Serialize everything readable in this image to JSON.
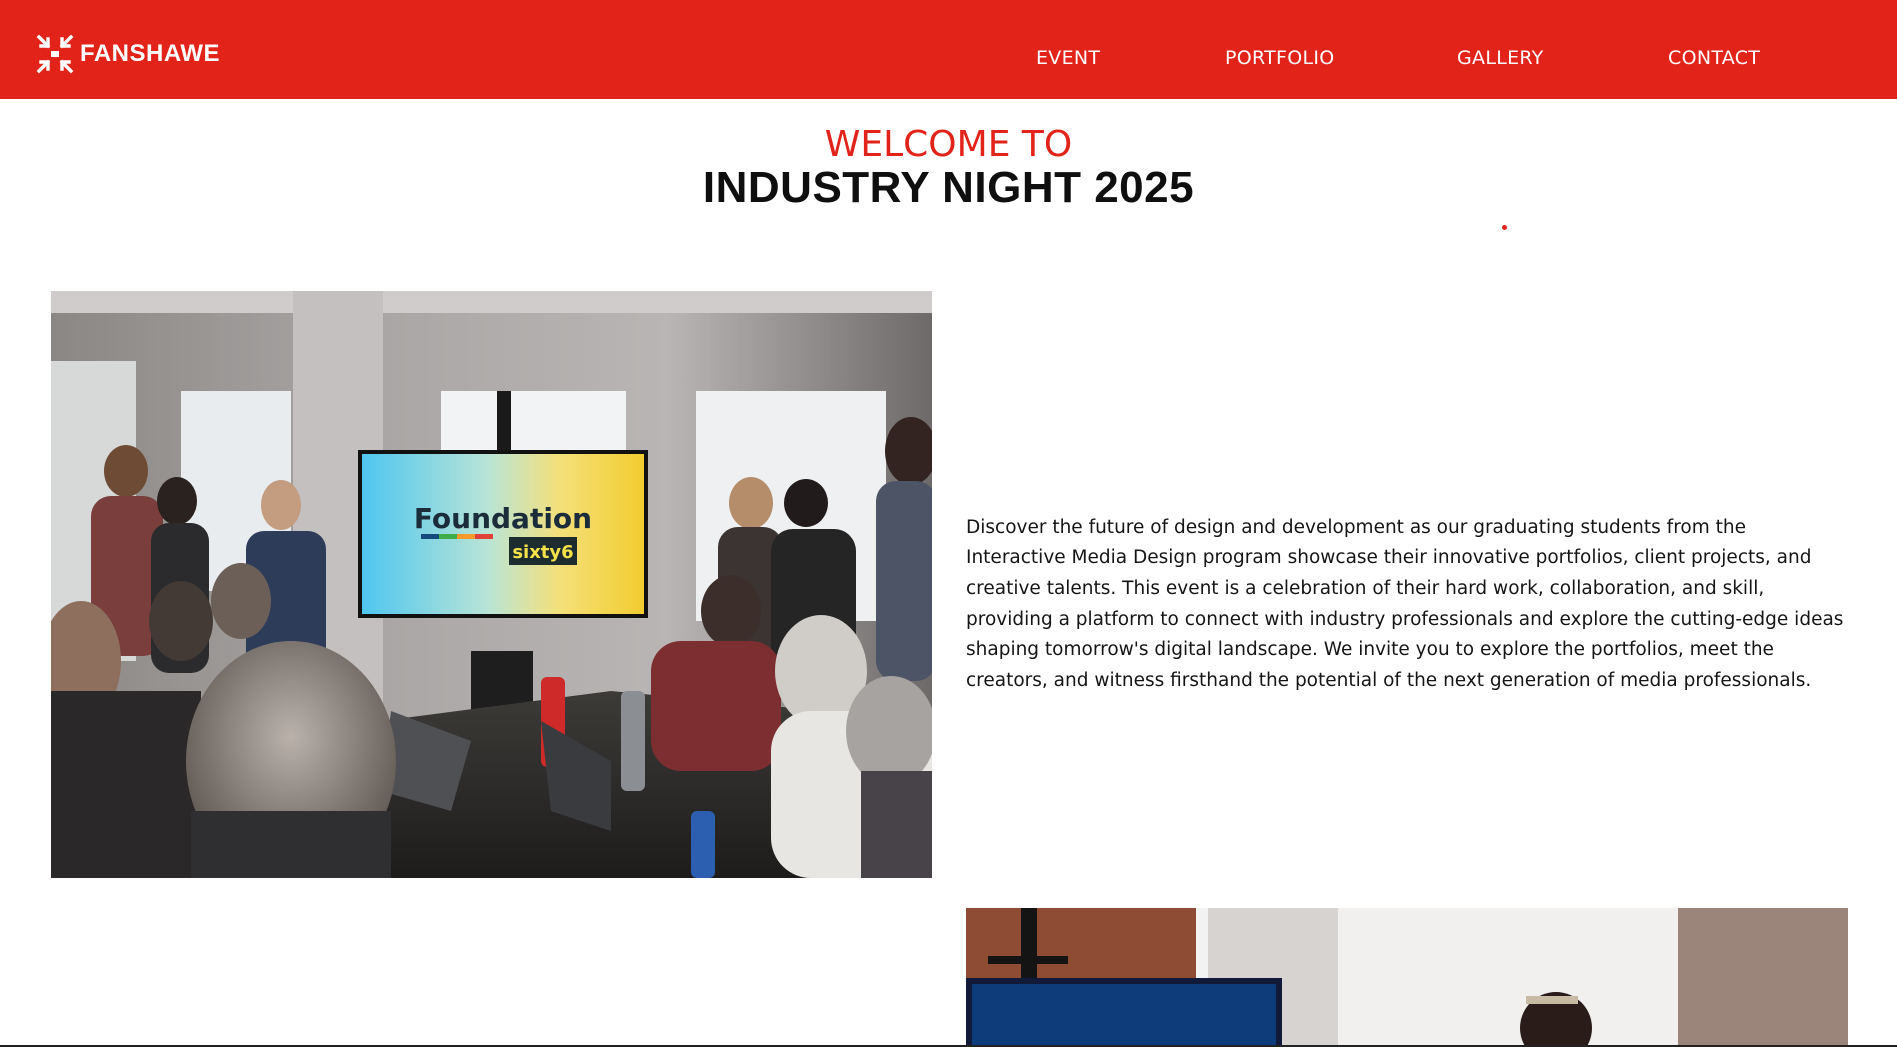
{
  "brand": {
    "name": "FANSHAWE",
    "color": "#e2231a"
  },
  "nav": {
    "event": "EVENT",
    "portfolio": "PORTFOLIO",
    "gallery": "GALLERY",
    "contact": "CONTACT"
  },
  "hero": {
    "welcome": "WELCOME TO",
    "title": "INDUSTRY NIGHT 2025"
  },
  "photo1": {
    "screen_title": "Foundation",
    "screen_sub": "sixty6"
  },
  "description": "Discover the future of design and development as our graduating students from the Interactive Media Design program showcase their innovative portfolios, client projects, and creative talents. This event is a celebration of their hard work, collaboration, and skill, providing a platform to connect with industry professionals and explore the cutting-edge ideas shaping tomorrow's digital landscape. We invite you to explore the portfolios, meet the creators, and witness firsthand the potential of the next generation of media professionals."
}
